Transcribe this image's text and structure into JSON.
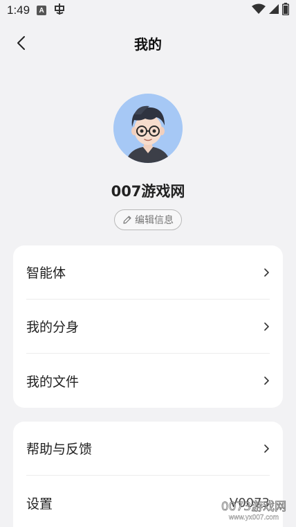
{
  "status_bar": {
    "time": "1:49",
    "icons": [
      "a-badge-icon",
      "notification-icon",
      "wifi-icon",
      "signal-icon",
      "battery-icon"
    ]
  },
  "header": {
    "title": "我的",
    "back_icon": "chevron-left-icon"
  },
  "profile": {
    "avatar": "avatar-cartoon-boy-glasses",
    "name": "007游戏网",
    "edit_label": "编辑信息",
    "edit_icon": "pencil-icon"
  },
  "menu_group_1": [
    {
      "label": "智能体"
    },
    {
      "label": "我的分身"
    },
    {
      "label": "我的文件"
    }
  ],
  "menu_group_2": [
    {
      "label": "帮助与反馈"
    },
    {
      "label": "设置",
      "value": "V0073"
    }
  ],
  "watermark": {
    "text": "0073游戏网",
    "url": "www.yx007.com"
  },
  "colors": {
    "background": "#f2f2f4",
    "card": "#ffffff",
    "avatar_bg": "#a6c8f5"
  }
}
